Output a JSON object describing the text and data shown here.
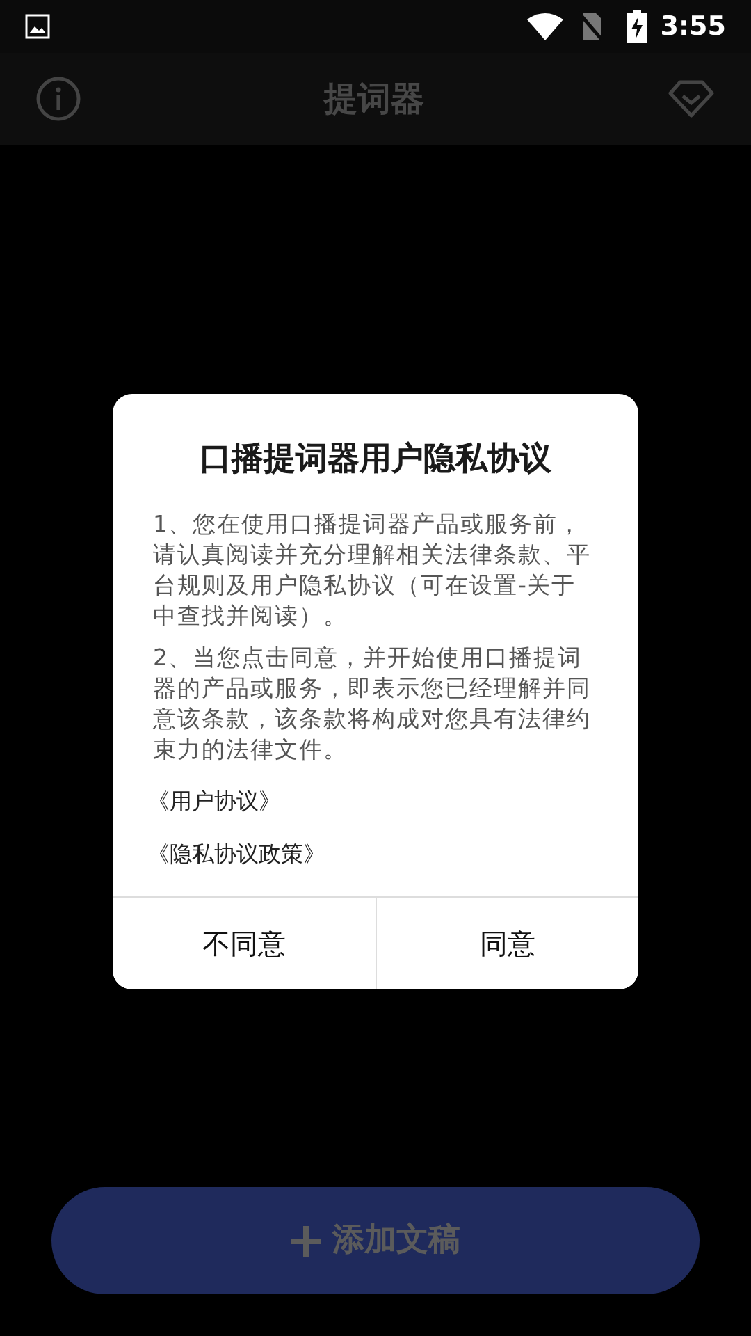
{
  "status_bar": {
    "time": "3:55"
  },
  "app_bar": {
    "title": "提词器"
  },
  "dialog": {
    "title": "口播提词器用户隐私协议",
    "paragraphs": [
      "1、您在使用口播提词器产品或服务前，请认真阅读并充分理解相关法律条款、平台规则及用户隐私协议（可在设置-关于中查找并阅读）。",
      "2、当您点击同意，并开始使用口播提词器的产品或服务，即表示您已经理解并同意该条款，该条款将构成对您具有法律约束力的法律文件。"
    ],
    "links": [
      "《用户协议》",
      "《隐私协议政策》"
    ],
    "buttons": [
      "不同意",
      "同意"
    ]
  },
  "add_button": {
    "label": "添加文稿"
  }
}
